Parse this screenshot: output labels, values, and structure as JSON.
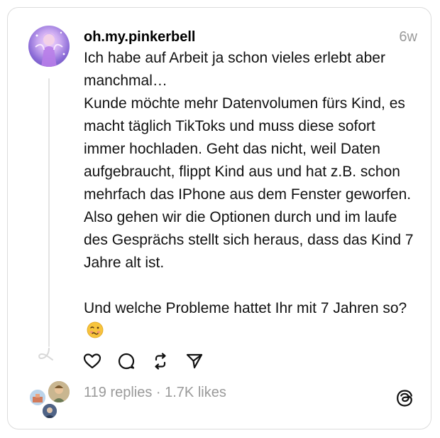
{
  "post": {
    "username": "oh.my.pinkerbell",
    "time_ago": "6w",
    "body": "Ich habe auf Arbeit ja schon vieles erlebt aber manchmal…\nKunde möchte mehr Datenvolumen fürs Kind, es macht täglich TikToks und muss diese sofort immer hochladen. Geht das nicht, weil Daten aufgebraucht, flippt Kind aus und hat z.B. schon mehrfach das IPhone aus dem Fenster geworfen. Also gehen wir die Optionen durch und im laufe des Gesprächs stellt sich heraus, dass das Kind 7 Jahre alt ist.\n\nUnd welche Probleme hattet Ihr mit 7 Jahren so?",
    "emoji": "woozy-face",
    "stats": "119 replies · 1.7K likes"
  },
  "actions": [
    {
      "name": "like",
      "icon": "heart-icon"
    },
    {
      "name": "reply",
      "icon": "comment-icon"
    },
    {
      "name": "repost",
      "icon": "repost-icon"
    },
    {
      "name": "share",
      "icon": "send-icon"
    }
  ],
  "colors": {
    "muted_text": "#9a9a9a",
    "border": "#dcdcdc",
    "thread_line": "#e3e3e3"
  }
}
